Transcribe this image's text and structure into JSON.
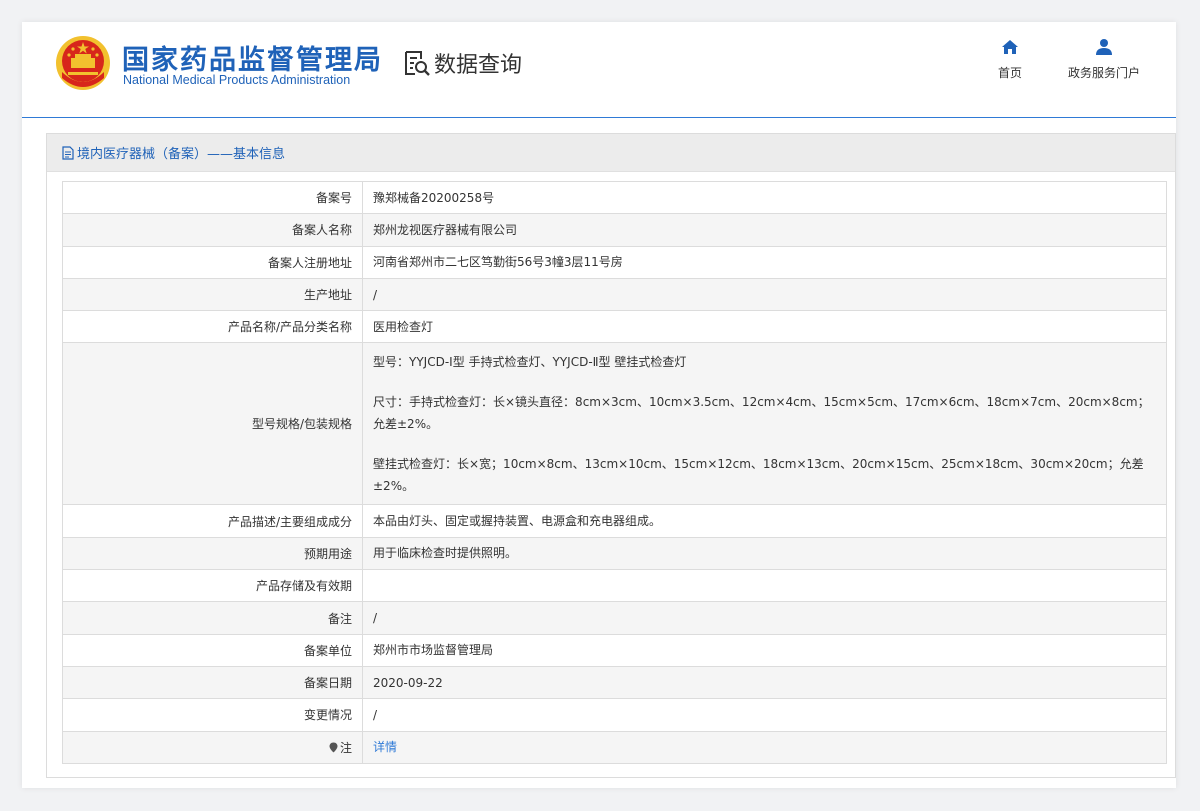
{
  "header": {
    "org_name_cn": "国家药品监督管理局",
    "org_name_en": "National Medical Products Administration",
    "query_label": "数据查询",
    "nav": {
      "home_label": "首页",
      "portal_label": "政务服务门户"
    }
  },
  "panel": {
    "title": "境内医疗器械（备案）——基本信息"
  },
  "record": {
    "rows": [
      {
        "label": "备案号",
        "value": "豫郑械备20200258号"
      },
      {
        "label": "备案人名称",
        "value": "郑州龙视医疗器械有限公司"
      },
      {
        "label": "备案人注册地址",
        "value": "河南省郑州市二七区笃勤街56号3幢3层11号房"
      },
      {
        "label": "生产地址",
        "value": "/"
      },
      {
        "label": "产品名称/产品分类名称",
        "value": "医用检查灯"
      },
      {
        "label": "型号规格/包装规格",
        "lines": [
          "型号：YYJCD-Ⅰ型 手持式检查灯、YYJCD-Ⅱ型 壁挂式检查灯",
          "尺寸：手持式检查灯：长×镜头直径：8cm×3cm、10cm×3.5cm、12cm×4cm、15cm×5cm、17cm×6cm、18cm×7cm、20cm×8cm；允差±2%。",
          "壁挂式检查灯：长×宽；10cm×8cm、13cm×10cm、15cm×12cm、18cm×13cm、20cm×15cm、25cm×18cm、30cm×20cm；允差±2%。"
        ]
      },
      {
        "label": "产品描述/主要组成成分",
        "value": "本品由灯头、固定或握持装置、电源盒和充电器组成。"
      },
      {
        "label": "预期用途",
        "value": "用于临床检查时提供照明。"
      },
      {
        "label": "产品存储及有效期",
        "value": ""
      },
      {
        "label": "备注",
        "value": "/"
      },
      {
        "label": "备案单位",
        "value": "郑州市市场监督管理局"
      },
      {
        "label": "备案日期",
        "value": "2020-09-22"
      },
      {
        "label": "变更情况",
        "value": "/"
      },
      {
        "label": "注",
        "value": "详情"
      }
    ]
  },
  "colors": {
    "brand_blue": "#1f62b8",
    "link_blue": "#2f7ad6",
    "emblem_red": "#d7261b",
    "emblem_gold": "#f2c12e"
  },
  "icons": {
    "emblem": "national-emblem-icon",
    "query": "document-search-icon",
    "home": "home-icon",
    "portal": "user-icon",
    "panel": "document-icon",
    "note": "map-pin-icon"
  }
}
